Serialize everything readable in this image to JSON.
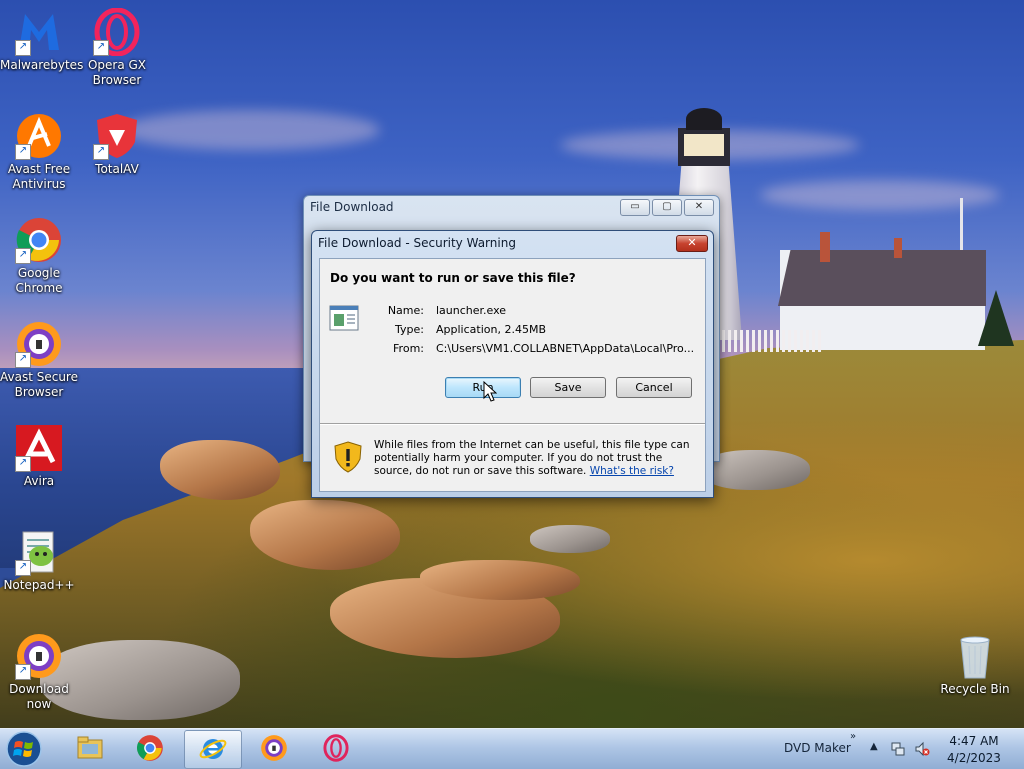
{
  "desktop": {
    "icons": [
      {
        "label": "Malwarebytes",
        "icon": "malwarebytes-icon"
      },
      {
        "label": "Opera GX Browser",
        "icon": "opera-gx-icon"
      },
      {
        "label": "Avast Free Antivirus",
        "icon": "avast-icon"
      },
      {
        "label": "TotalAV",
        "icon": "totalav-icon"
      },
      {
        "label": "Google Chrome",
        "icon": "chrome-icon"
      },
      {
        "label": "Avast Secure Browser",
        "icon": "avast-secure-browser-icon"
      },
      {
        "label": "Avira",
        "icon": "avira-icon"
      },
      {
        "label": "Notepad++",
        "icon": "notepadpp-icon"
      },
      {
        "label": "Download now",
        "icon": "avast-secure-browser-icon"
      },
      {
        "label": "Recycle Bin",
        "icon": "recycle-bin-icon"
      }
    ]
  },
  "background_window": {
    "title": "File Download",
    "buttons": {
      "minimize": "▭",
      "maximize": "▢",
      "close": "✕"
    }
  },
  "dialog": {
    "title": "File Download - Security Warning",
    "close": "✕",
    "question": "Do you want to run or save this file?",
    "fields": [
      {
        "label": "Name:",
        "value": "launcher.exe"
      },
      {
        "label": "Type:",
        "value": "Application, 2.45MB"
      },
      {
        "label": "From:",
        "value": "C:\\Users\\VM1.COLLABNET\\AppData\\Local\\Pro..."
      }
    ],
    "buttons": {
      "run": "Run",
      "save": "Save",
      "cancel": "Cancel"
    },
    "warning_text": "While files from the Internet can be useful, this file type can potentially harm your computer. If you do not trust the source, do not run or save this software.",
    "risk_link": "What's the risk?"
  },
  "taskbar": {
    "pinned": [
      "windows-explorer-icon",
      "chrome-icon",
      "internet-explorer-icon",
      "avast-secure-browser-icon",
      "opera-icon"
    ],
    "active": "internet-explorer-icon",
    "tray_label": "DVD Maker",
    "chevron": "»",
    "tray_up": "▲",
    "time": "4:47 AM",
    "date": "4/2/2023"
  },
  "colors": {
    "accent": "#3c7fb1",
    "link": "#0645ad",
    "taskbar": "#a9c3e4"
  }
}
